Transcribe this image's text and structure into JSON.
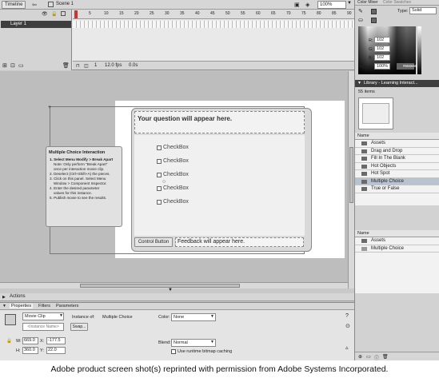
{
  "timeline": {
    "tab": "Timeline",
    "scene": "Scene 1",
    "zoom": "100%",
    "layer": "Layer 1",
    "frame_numbers": [
      "5",
      "10",
      "15",
      "20",
      "25",
      "30",
      "35",
      "40",
      "45",
      "50",
      "55",
      "60",
      "65",
      "70",
      "75",
      "80",
      "85",
      "90"
    ],
    "status": [
      "1",
      "12.0 fps",
      "0.0s"
    ]
  },
  "stage": {
    "question": "Your question will appear here.",
    "checkboxes": [
      "CheckBox",
      "CheckBox",
      "CheckBox",
      "CheckBox",
      "CheckBox"
    ],
    "control_button": "Control Button",
    "feedback": "Feedback will appear here."
  },
  "instructions": {
    "title": "Multiple Choice Interaction",
    "steps": [
      "1. Select Menu Modify > Break Apart",
      "Note: Only perform \"Break Apart\"",
      "once per interaction movie clip.",
      "2. Deselect (Ctrl+Shift+A) the pieces.",
      "3. Click on this panel. Select Menu",
      "Window > Component Inspector.",
      "4. Enter the desired parameter",
      "values for this instance.",
      "5. Publish movie to see the results."
    ]
  },
  "color_mixer": {
    "tabs": [
      "Color Mixer",
      "Color Swatches"
    ],
    "type_label": "Type:",
    "type_value": "Solid",
    "r_label": "R:",
    "r": "102",
    "g_label": "G:",
    "g": "102",
    "b_label": "B:",
    "b": "102",
    "alpha_label": "Alpha:",
    "alpha": "100%",
    "hex": "#666666"
  },
  "library": {
    "title": "Library - Learning Interact...",
    "count": "55 items",
    "name_col": "Name",
    "items": [
      "Assets",
      "Drag and Drop",
      "Fill In The Blank",
      "Hot Objects",
      "Hot Spot",
      "Multiple Choice",
      "True or False"
    ],
    "selected_index": 5,
    "lower_name_col": "Name",
    "lower_items": [
      "Assets",
      "Multiple Choice"
    ]
  },
  "actions": {
    "label": "Actions"
  },
  "properties": {
    "tabs": [
      "Properties",
      "Filters",
      "Parameters"
    ],
    "symbol_type": "Movie Clip",
    "instance_of_label": "Instance of:",
    "instance_of_value": "Multiple Choice",
    "instance_name_placeholder": "<Instance Name>",
    "swap": "Swap...",
    "color_label": "Color:",
    "color_value": "None",
    "w_label": "W:",
    "w": "669.0",
    "x_label": "X:",
    "x": "-177.5",
    "h_label": "H:",
    "h": "360.0",
    "y_label": "Y:",
    "y": "22.0",
    "blend_label": "Blend:",
    "blend": "Normal",
    "runtime_cache": "Use runtime bitmap caching"
  },
  "caption": "Adobe product screen shot(s) reprinted with permission from Adobe Systems Incorporated."
}
